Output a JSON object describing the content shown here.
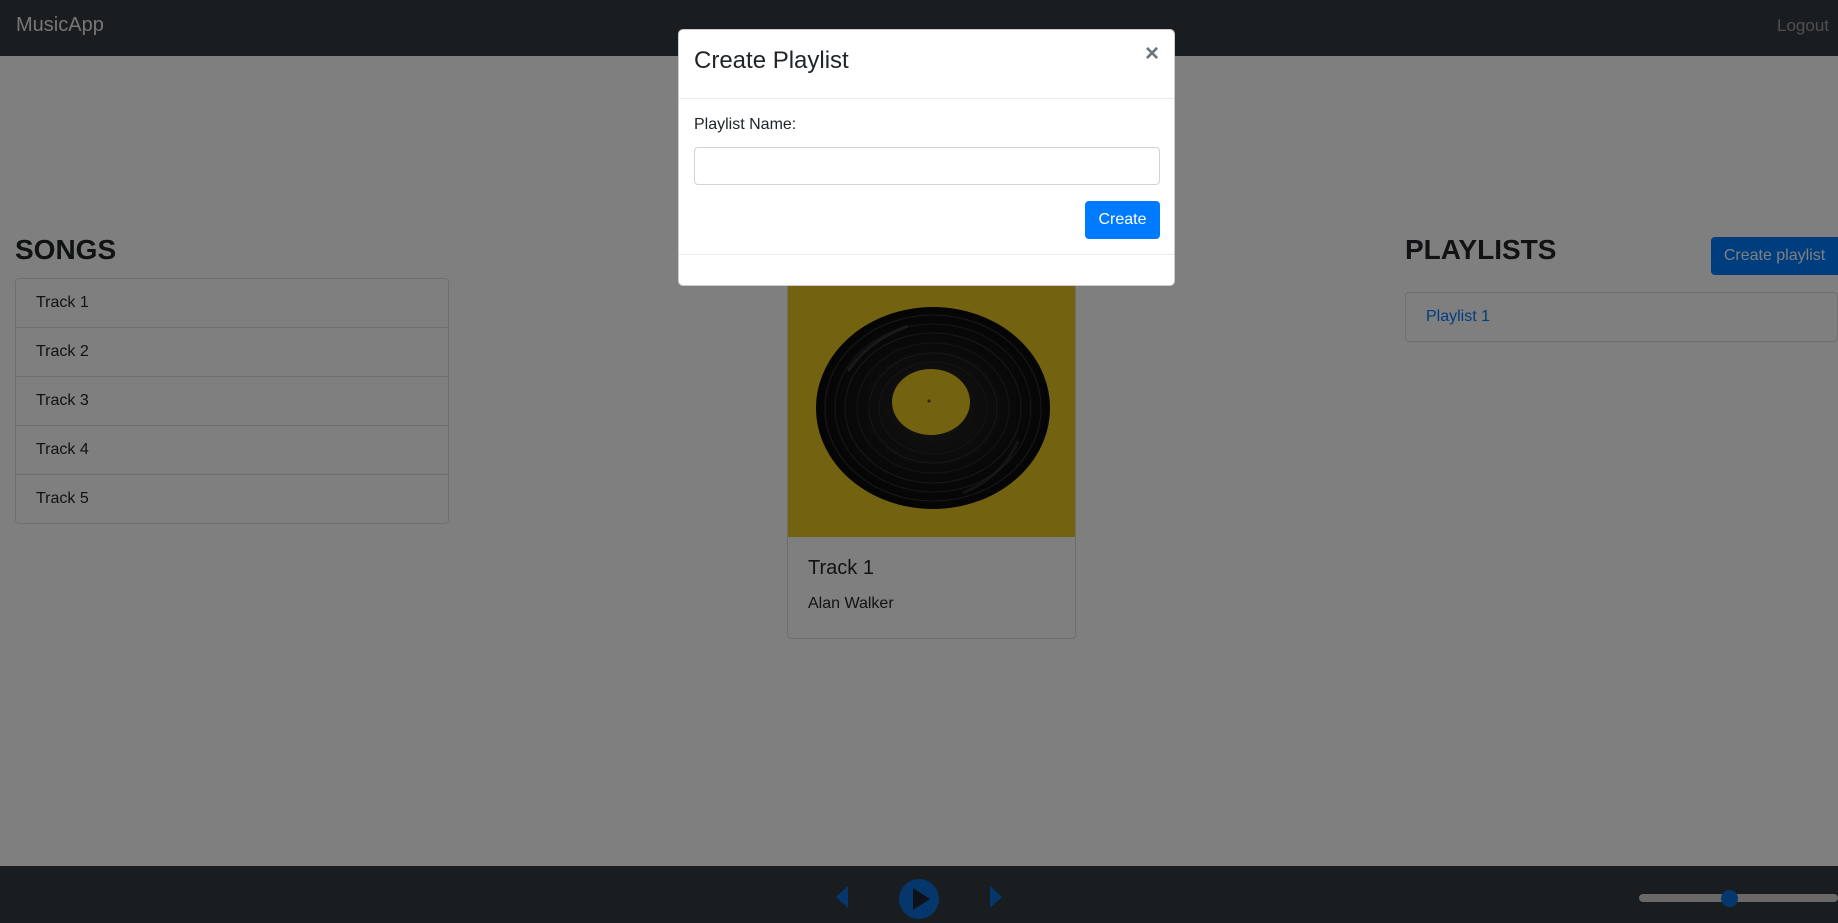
{
  "navbar": {
    "brand": "MusicApp",
    "logout_label": "Logout"
  },
  "songs": {
    "title": "SONGS",
    "items": [
      {
        "label": "Track 1"
      },
      {
        "label": "Track 2"
      },
      {
        "label": "Track 3"
      },
      {
        "label": "Track 4"
      },
      {
        "label": "Track 5"
      }
    ]
  },
  "now_playing": {
    "title": "Track 1",
    "artist": "Alan Walker",
    "cover_icon": "vinyl-record-icon",
    "cover_color": "#e6c51e"
  },
  "playlists": {
    "title": "PLAYLISTS",
    "create_label": "Create playlist",
    "items": [
      {
        "label": "Playlist 1"
      }
    ]
  },
  "player": {
    "prev_icon": "previous-icon",
    "play_icon": "play-icon",
    "next_icon": "next-icon",
    "volume_percent": 45
  },
  "modal": {
    "title": "Create Playlist",
    "close_label": "×",
    "name_label": "Playlist Name:",
    "name_value": "",
    "name_placeholder": "",
    "submit_label": "Create"
  },
  "colors": {
    "primary": "#007bff",
    "navbar": "#343a40",
    "overlay": "rgba(0,0,0,0.5)"
  }
}
